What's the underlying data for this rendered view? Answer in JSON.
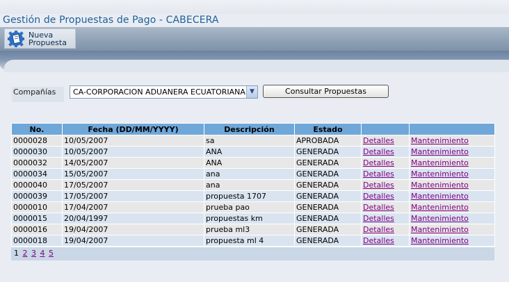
{
  "page": {
    "title": "Gestión de Propuestas de Pago - CABECERA"
  },
  "toolbar": {
    "new_proposal_label": "Nueva Propuesta",
    "new_proposal_icon": "document-gear-icon"
  },
  "filter": {
    "company_label": "Compañías",
    "company_selected": "CA-CORPORACION ADUANERA ECUATORIANA",
    "consult_button": "Consultar Propuestas"
  },
  "table": {
    "headers": [
      "No.",
      "Fecha (DD/MM/YYYY)",
      "Descripción",
      "Estado",
      "",
      ""
    ],
    "rows": [
      {
        "no": "0000028",
        "fecha": "10/05/2007",
        "descripcion": "sa",
        "estado": "APROBADA",
        "detalles": "Detalles",
        "mantenimiento": "Mantenimiento"
      },
      {
        "no": "0000030",
        "fecha": "10/05/2007",
        "descripcion": "ANA",
        "estado": "GENERADA",
        "detalles": "Detalles",
        "mantenimiento": "Mantenimiento"
      },
      {
        "no": "0000032",
        "fecha": "14/05/2007",
        "descripcion": "ANA",
        "estado": "GENERADA",
        "detalles": "Detalles",
        "mantenimiento": "Mantenimiento"
      },
      {
        "no": "0000034",
        "fecha": "15/05/2007",
        "descripcion": "ana",
        "estado": "GENERADA",
        "detalles": "Detalles",
        "mantenimiento": "Mantenimiento"
      },
      {
        "no": "0000040",
        "fecha": "17/05/2007",
        "descripcion": "ana",
        "estado": "GENERADA",
        "detalles": "Detalles",
        "mantenimiento": "Mantenimiento"
      },
      {
        "no": "0000039",
        "fecha": "17/05/2007",
        "descripcion": "propuesta 1707",
        "estado": "GENERADA",
        "detalles": "Detalles",
        "mantenimiento": "Mantenimiento"
      },
      {
        "no": "0000010",
        "fecha": "17/04/2007",
        "descripcion": "prueba pao",
        "estado": "GENERADA",
        "detalles": "Detalles",
        "mantenimiento": "Mantenimiento"
      },
      {
        "no": "0000015",
        "fecha": "20/04/1997",
        "descripcion": "propuestas km",
        "estado": "GENERADA",
        "detalles": "Detalles",
        "mantenimiento": "Mantenimiento"
      },
      {
        "no": "0000016",
        "fecha": "19/04/2007",
        "descripcion": "prueba ml3",
        "estado": "GENERADA",
        "detalles": "Detalles",
        "mantenimiento": "Mantenimiento"
      },
      {
        "no": "0000018",
        "fecha": "19/04/2007",
        "descripcion": "propuesta ml 4",
        "estado": "GENERADA",
        "detalles": "Detalles",
        "mantenimiento": "Mantenimiento"
      }
    ]
  },
  "pager": {
    "current": "1",
    "pages": [
      "2",
      "3",
      "4",
      "5"
    ]
  },
  "colors": {
    "title": "#1f5f99",
    "header_bg": "#6fa7d9",
    "link": "#800080",
    "row_odd": "#e7e7e7",
    "row_even": "#d9e4f0"
  }
}
